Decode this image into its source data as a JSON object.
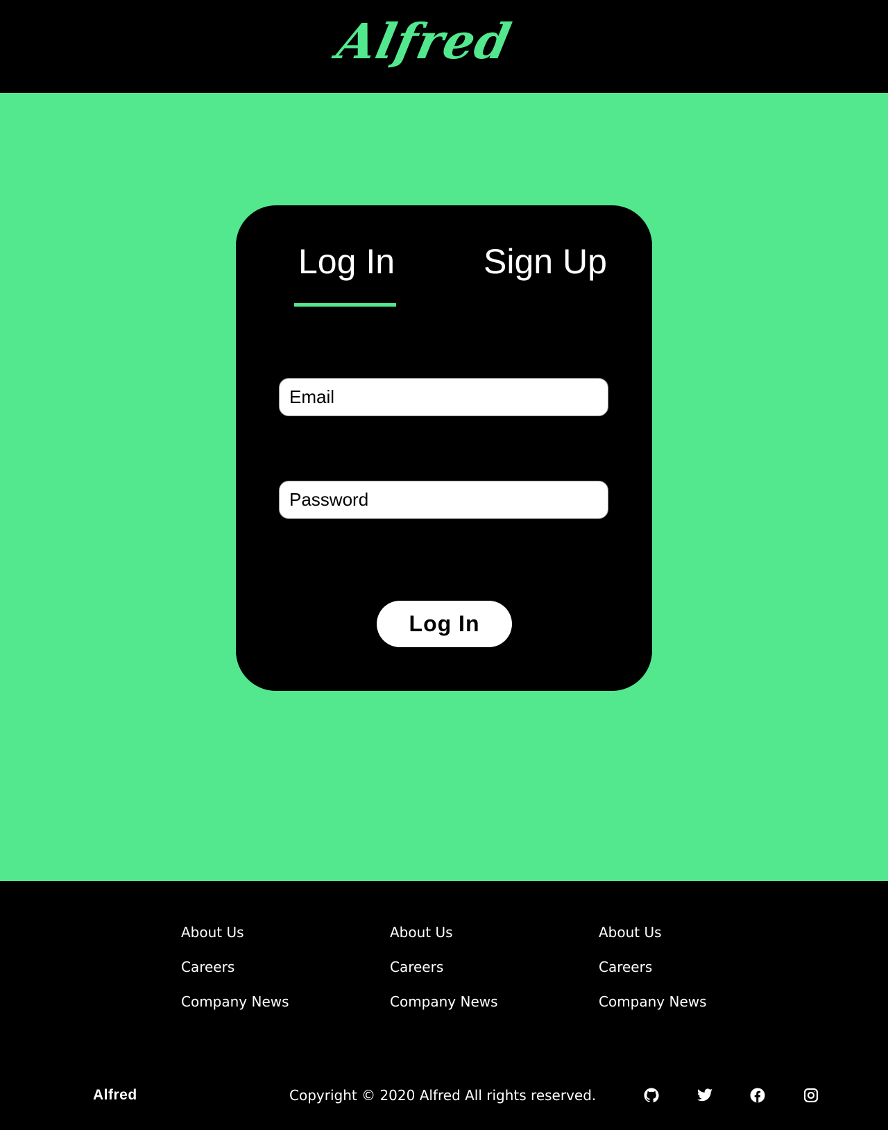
{
  "brand": {
    "logo_text": "Alfred"
  },
  "auth_card": {
    "tabs": [
      {
        "label": "Log In",
        "active": true
      },
      {
        "label": "Sign Up",
        "active": false
      }
    ],
    "email": {
      "placeholder": "Email",
      "value": ""
    },
    "password": {
      "placeholder": "Password",
      "value": ""
    },
    "submit_label": "Log In"
  },
  "footer": {
    "columns": [
      {
        "links": [
          "About Us",
          "Careers",
          "Company News"
        ]
      },
      {
        "links": [
          "About Us",
          "Careers",
          "Company News"
        ]
      },
      {
        "links": [
          "About Us",
          "Careers",
          "Company News"
        ]
      }
    ],
    "brand": "Alfred",
    "copyright": "Copyright © 2020 Alfred All rights reserved.",
    "social_icons": [
      "github-icon",
      "twitter-icon",
      "facebook-icon",
      "instagram-icon"
    ]
  },
  "colors": {
    "accent": "#53e88e",
    "background_dark": "#000000",
    "text_light": "#ffffff"
  }
}
